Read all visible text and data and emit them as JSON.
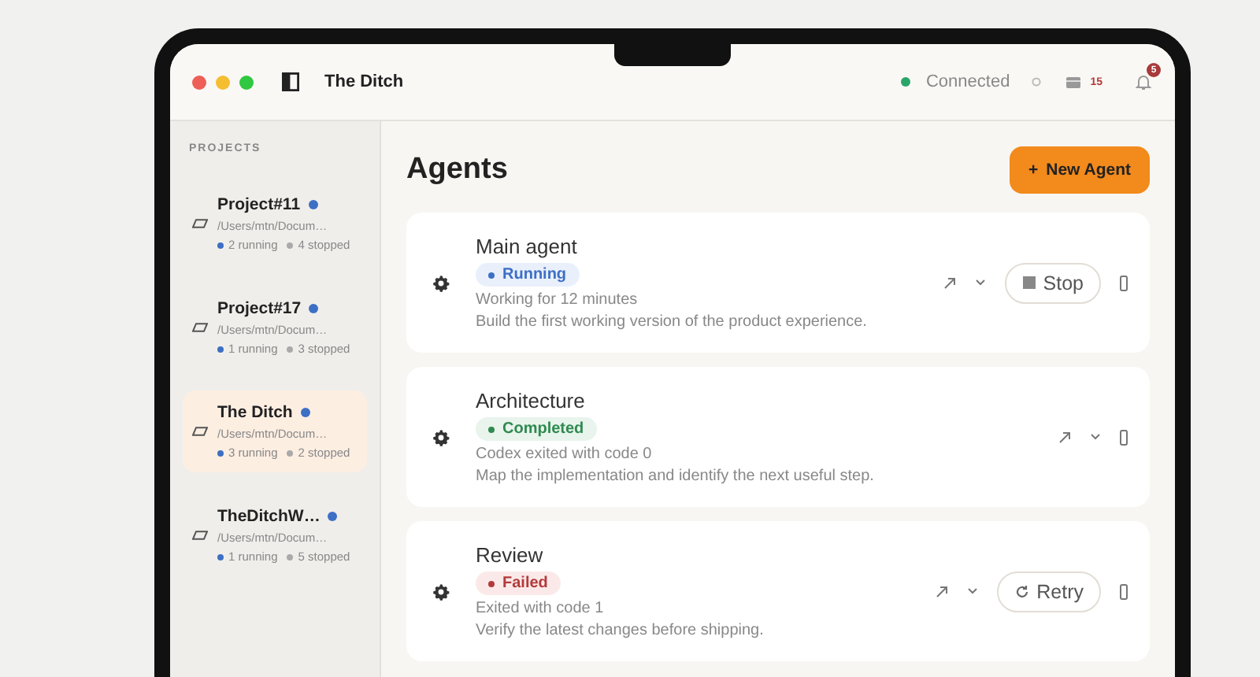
{
  "window": {
    "title": "The Ditch"
  },
  "status": {
    "connection": "Connected",
    "connected": true,
    "messages_count": "15",
    "notifications_count": "5"
  },
  "sidebar": {
    "heading": "PROJECTS",
    "items": [
      {
        "name": "Project#11",
        "path": "/Users/mtn/Docum…",
        "running": "2 running",
        "stopped": "4 stopped",
        "selected": false
      },
      {
        "name": "Project#17",
        "path": "/Users/mtn/Docum…",
        "running": "1 running",
        "stopped": "3 stopped",
        "selected": false
      },
      {
        "name": "The Ditch",
        "path": "/Users/mtn/Docum…",
        "running": "3 running",
        "stopped": "2 stopped",
        "selected": true
      },
      {
        "name": "TheDitchW…",
        "path": "/Users/mtn/Docum…",
        "running": "1 running",
        "stopped": "5 stopped",
        "selected": false
      }
    ]
  },
  "main": {
    "title": "Agents",
    "new_button": "New Agent",
    "new_button_icon": "+"
  },
  "agents": [
    {
      "name": "Main agent",
      "status": "Running",
      "kind": "running",
      "detail": "Working for 12 minutes",
      "description": "Build the first working version of the product experience.",
      "action": "Stop"
    },
    {
      "name": "Architecture",
      "status": "Completed",
      "kind": "completed",
      "detail": "Codex exited with code 0",
      "description": "Map the implementation and identify the next useful step."
    },
    {
      "name": "Review",
      "status": "Failed",
      "kind": "failed",
      "detail": "Exited with code 1",
      "description": "Verify the latest changes before shipping.",
      "action": "Retry"
    }
  ]
}
